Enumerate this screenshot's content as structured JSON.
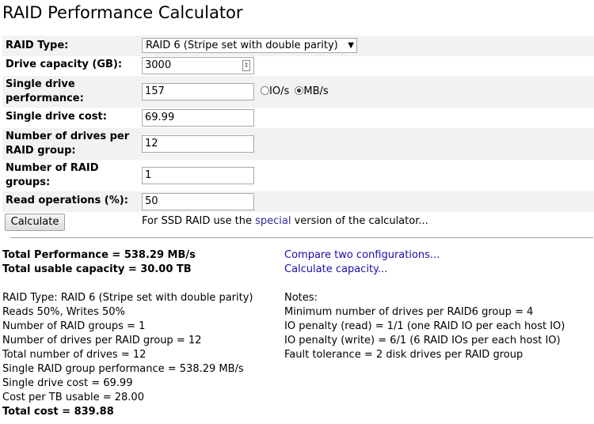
{
  "page": {
    "title": "RAID Performance Calculator"
  },
  "form": {
    "raid_type": {
      "label": "RAID Type:",
      "value": "RAID 6 (Stripe set with double parity)"
    },
    "drive_capacity": {
      "label": "Drive capacity (GB):",
      "value": "3000"
    },
    "single_drive_performance": {
      "label_line1": "Single drive",
      "label_line2": "performance:",
      "value": "157",
      "unit_options": [
        "IO/s",
        "MB/s"
      ],
      "selected_unit": "MB/s"
    },
    "single_drive_cost": {
      "label": "Single drive cost:",
      "value": "69.99"
    },
    "drives_per_group": {
      "label_line1": "Number of drives per",
      "label_line2": "RAID group:",
      "value": "12"
    },
    "raid_groups": {
      "label_line1": "Number of RAID",
      "label_line2": "groups:",
      "value": "1"
    },
    "read_operations": {
      "label": "Read operations (%):",
      "value": "50"
    },
    "calculate_label": "Calculate",
    "ssd_note": {
      "prefix": "For SSD RAID use the ",
      "link": "special",
      "suffix": " version of the calculator..."
    }
  },
  "summary": {
    "total_performance": "Total Performance = 538.29 MB/s",
    "total_usable_capacity": "Total usable capacity = 30.00 TB",
    "compare_link": "Compare two configurations...",
    "capacity_link": "Calculate capacity..."
  },
  "details": [
    "RAID Type: RAID 6 (Stripe set with double parity)",
    "Reads 50%, Writes 50%",
    "Number of RAID groups = 1",
    "Number of drives per RAID group = 12",
    "Total number of drives = 12",
    "Single RAID group performance = 538.29 MB/s",
    "Single drive cost = 69.99",
    "Cost per TB usable = 28.00"
  ],
  "total_cost": "Total cost = 839.88",
  "notes": {
    "heading": "Notes:",
    "items": [
      "Minimum number of drives per RAID6 group = 4",
      "IO penalty (read) = 1/1 (one RAID IO per each host IO)",
      "IO penalty (write) = 6/1 (6 RAID IOs per each host IO)",
      "Fault tolerance = 2 disk drives per RAID group"
    ]
  }
}
